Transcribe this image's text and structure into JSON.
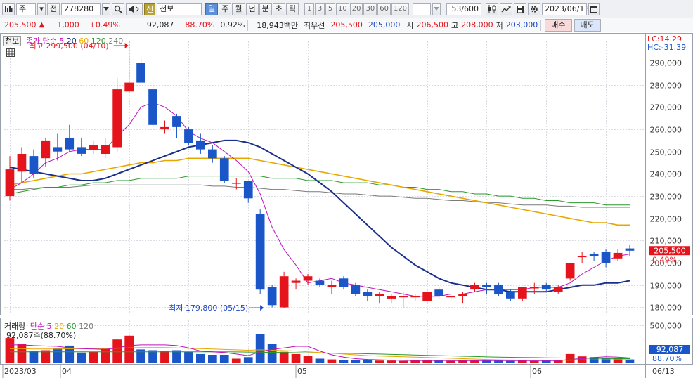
{
  "toolbar": {
    "menu_icon": "menu-icon",
    "market": "주",
    "market_arrow": "▾",
    "prev_label": "전",
    "code": "278280",
    "new_badge": "신",
    "stock_name": "천보",
    "periods": [
      "일",
      "주",
      "월",
      "년",
      "분",
      "초",
      "틱"
    ],
    "active_period": "일",
    "intervals": [
      "1",
      "3",
      "5",
      "10",
      "20",
      "30",
      "60",
      "120"
    ],
    "count": "53/600",
    "date": "2023/06/13"
  },
  "quote": {
    "price": "205,500",
    "arrow": "▲",
    "change": "1,000",
    "change_pct": "+0.49%",
    "volume": "92,087",
    "vol_ratio": "88.70%",
    "turnover_pct": "0.92%",
    "amount": "18,943백만",
    "best_ask_label": "최우선",
    "best_ask": "205,500",
    "best_bid": "205,000",
    "open_label": "시",
    "open": "206,500",
    "high_label": "고",
    "high": "208,000",
    "low_label": "저",
    "low": "203,000",
    "buy_button": "매수",
    "sell_button": "매도"
  },
  "legend": {
    "name": "천보",
    "series_label": "종가 단순",
    "ma": [
      "5",
      "20",
      "60",
      "120",
      "240"
    ],
    "ma_colors": [
      "#c010c0",
      "#1a2f8a",
      "#e6a700",
      "#2a9a2a",
      "#7a7a7a"
    ],
    "high_note": "최고 299,500 (04/10)",
    "low_note": "최저 179,800 (05/15)",
    "lc": "LC:14.29",
    "hc": "HC:-31.39"
  },
  "volume_legend": {
    "title": "거래량",
    "series_label": "단순",
    "ma": [
      "5",
      "20",
      "60",
      "120"
    ],
    "ma_colors": [
      "#c010c0",
      "#e6a700",
      "#2a9a2a",
      "#7a7a7a"
    ],
    "current": "92,087주(88.70%)"
  },
  "axis": {
    "price_ticks": [
      "290,000",
      "280,000",
      "270,000",
      "260,000",
      "250,000",
      "240,000",
      "230,000",
      "220,000",
      "210,000",
      "200,000",
      "190,000",
      "180,000"
    ],
    "current_price_label": "205,500",
    "current_pct_label": "0.49%",
    "volume_ticks": [
      "500,000"
    ],
    "current_volume_label": "92,087",
    "current_volume_pct": "88.70%",
    "date_labels": [
      "2023/03",
      "04",
      "05",
      "06",
      "06/13"
    ]
  },
  "colors": {
    "up": "#e5141c",
    "down": "#1a56c8",
    "grid": "#d8dce2",
    "price_tag": "#e5141c"
  },
  "chart_data": {
    "type": "candlestick",
    "price_ylim": [
      177000,
      299500
    ],
    "candles": [
      {
        "o": 230000,
        "h": 248000,
        "l": 228000,
        "c": 242000
      },
      {
        "o": 241000,
        "h": 252000,
        "l": 236000,
        "c": 249000
      },
      {
        "o": 248000,
        "h": 251000,
        "l": 238000,
        "c": 240000
      },
      {
        "o": 247000,
        "h": 256000,
        "l": 243000,
        "c": 255000
      },
      {
        "o": 252000,
        "h": 258000,
        "l": 246000,
        "c": 250000
      },
      {
        "o": 256000,
        "h": 262000,
        "l": 250000,
        "c": 251000
      },
      {
        "o": 252000,
        "h": 256000,
        "l": 248000,
        "c": 249000
      },
      {
        "o": 251000,
        "h": 255000,
        "l": 249000,
        "c": 253000
      },
      {
        "o": 249000,
        "h": 256000,
        "l": 247000,
        "c": 253000
      },
      {
        "o": 252000,
        "h": 283000,
        "l": 250000,
        "c": 278000
      },
      {
        "o": 277000,
        "h": 299500,
        "l": 276000,
        "c": 281000
      },
      {
        "o": 290000,
        "h": 292000,
        "l": 281000,
        "c": 281000
      },
      {
        "o": 278000,
        "h": 283000,
        "l": 260000,
        "c": 262000
      },
      {
        "o": 260000,
        "h": 264000,
        "l": 258000,
        "c": 261000
      },
      {
        "o": 266000,
        "h": 267000,
        "l": 256000,
        "c": 261000
      },
      {
        "o": 260000,
        "h": 261000,
        "l": 253000,
        "c": 254000
      },
      {
        "o": 255000,
        "h": 258000,
        "l": 249000,
        "c": 251000
      },
      {
        "o": 251000,
        "h": 253000,
        "l": 245000,
        "c": 247000
      },
      {
        "o": 247000,
        "h": 248000,
        "l": 236000,
        "c": 237000
      },
      {
        "o": 236000,
        "h": 238000,
        "l": 233000,
        "c": 236000
      },
      {
        "o": 237000,
        "h": 237000,
        "l": 227000,
        "c": 229000
      },
      {
        "o": 222000,
        "h": 224000,
        "l": 186000,
        "c": 188000
      },
      {
        "o": 189000,
        "h": 190000,
        "l": 180000,
        "c": 181000
      },
      {
        "o": 180000,
        "h": 196000,
        "l": 179800,
        "c": 194000
      },
      {
        "o": 191000,
        "h": 193000,
        "l": 188000,
        "c": 192000
      },
      {
        "o": 192000,
        "h": 195000,
        "l": 190000,
        "c": 194000
      },
      {
        "o": 192000,
        "h": 193000,
        "l": 189000,
        "c": 190000
      },
      {
        "o": 189000,
        "h": 192000,
        "l": 186000,
        "c": 190000
      },
      {
        "o": 193000,
        "h": 194000,
        "l": 188000,
        "c": 189000
      },
      {
        "o": 190000,
        "h": 191000,
        "l": 185000,
        "c": 186000
      },
      {
        "o": 187000,
        "h": 188000,
        "l": 183000,
        "c": 185000
      },
      {
        "o": 185000,
        "h": 187000,
        "l": 182000,
        "c": 186000
      },
      {
        "o": 184000,
        "h": 186000,
        "l": 182000,
        "c": 185000
      },
      {
        "o": 185000,
        "h": 187000,
        "l": 180000,
        "c": 185000
      },
      {
        "o": 185000,
        "h": 186000,
        "l": 183000,
        "c": 185000
      },
      {
        "o": 183000,
        "h": 188000,
        "l": 182000,
        "c": 187000
      },
      {
        "o": 188000,
        "h": 189000,
        "l": 184000,
        "c": 185000
      },
      {
        "o": 185000,
        "h": 186000,
        "l": 183000,
        "c": 185000
      },
      {
        "o": 185000,
        "h": 187000,
        "l": 182000,
        "c": 186000
      },
      {
        "o": 188000,
        "h": 191000,
        "l": 187000,
        "c": 190000
      },
      {
        "o": 190000,
        "h": 191000,
        "l": 186000,
        "c": 189000
      },
      {
        "o": 190000,
        "h": 191000,
        "l": 185000,
        "c": 186000
      },
      {
        "o": 187000,
        "h": 188000,
        "l": 183000,
        "c": 184000
      },
      {
        "o": 184000,
        "h": 189000,
        "l": 183000,
        "c": 189000
      },
      {
        "o": 189000,
        "h": 191000,
        "l": 186000,
        "c": 189000
      },
      {
        "o": 190000,
        "h": 191000,
        "l": 187000,
        "c": 188000
      },
      {
        "o": 187000,
        "h": 190000,
        "l": 186000,
        "c": 189000
      },
      {
        "o": 193000,
        "h": 200000,
        "l": 192000,
        "c": 200000
      },
      {
        "o": 203000,
        "h": 205000,
        "l": 200000,
        "c": 203000
      },
      {
        "o": 204000,
        "h": 205000,
        "l": 201000,
        "c": 203000
      },
      {
        "o": 205000,
        "h": 206000,
        "l": 198000,
        "c": 200000
      },
      {
        "o": 202000,
        "h": 206000,
        "l": 201000,
        "c": 204500
      },
      {
        "o": 206500,
        "h": 208000,
        "l": 203000,
        "c": 205500
      }
    ],
    "ma5": [
      233000,
      236000,
      240000,
      245000,
      247000,
      250000,
      251000,
      251000,
      251000,
      257000,
      262000,
      270000,
      272000,
      270000,
      266000,
      259000,
      256000,
      254000,
      250000,
      246000,
      241000,
      231000,
      216000,
      206000,
      199000,
      191000,
      192000,
      193000,
      191000,
      190000,
      189000,
      188000,
      187000,
      186000,
      185000,
      185000,
      185000,
      186000,
      186000,
      187000,
      188000,
      188000,
      188000,
      188000,
      189000,
      189000,
      189000,
      191000,
      195000,
      198000,
      201000,
      203000,
      204000
    ],
    "ma20": [
      243000,
      242000,
      241000,
      240000,
      239000,
      238000,
      237000,
      237000,
      238000,
      240000,
      242000,
      244000,
      246000,
      248000,
      250000,
      252000,
      253000,
      254000,
      255000,
      255000,
      254000,
      252000,
      249000,
      246000,
      243000,
      240000,
      236000,
      232000,
      227000,
      222000,
      217000,
      212000,
      207000,
      203000,
      199000,
      196000,
      193000,
      191000,
      190000,
      189000,
      188000,
      188000,
      187000,
      187000,
      187000,
      187000,
      188000,
      189000,
      190000,
      190000,
      191000,
      191000,
      192000
    ],
    "ma60": [
      235000,
      236000,
      237000,
      238000,
      239000,
      240000,
      240000,
      241000,
      242000,
      243000,
      244000,
      245000,
      245000,
      246000,
      246000,
      247000,
      247000,
      247000,
      247000,
      247000,
      247000,
      246000,
      245000,
      244000,
      243000,
      242000,
      241000,
      240000,
      239000,
      238000,
      237000,
      236000,
      235000,
      234000,
      233000,
      232000,
      231000,
      230000,
      229000,
      228000,
      227000,
      226000,
      225000,
      224000,
      223000,
      222000,
      221000,
      220000,
      219000,
      218000,
      218000,
      217000,
      217000
    ],
    "ma120": [
      231000,
      232000,
      233000,
      234000,
      234000,
      235000,
      235000,
      236000,
      236000,
      237000,
      237000,
      238000,
      238000,
      238000,
      238000,
      239000,
      239000,
      239000,
      239000,
      239000,
      239000,
      239000,
      238000,
      238000,
      238000,
      237000,
      237000,
      237000,
      236000,
      236000,
      236000,
      235000,
      235000,
      234000,
      234000,
      233000,
      233000,
      232000,
      232000,
      231000,
      231000,
      230000,
      230000,
      229000,
      229000,
      228000,
      228000,
      227000,
      227000,
      227000,
      226000,
      226000,
      226000
    ],
    "ma240": [
      233000,
      233000,
      233500,
      234000,
      234000,
      234000,
      234500,
      235000,
      235000,
      235000,
      235000,
      235000,
      235000,
      235000,
      235000,
      235000,
      235000,
      234500,
      234500,
      234000,
      234000,
      233500,
      233000,
      233000,
      232500,
      232000,
      232000,
      231500,
      231000,
      231000,
      230500,
      230000,
      230000,
      229500,
      229000,
      229000,
      228500,
      228000,
      228000,
      227500,
      227000,
      227000,
      226500,
      226000,
      226000,
      226000,
      225500,
      225500,
      225000,
      225000,
      225000,
      225000,
      225000
    ],
    "volume_ylim": [
      0,
      560000
    ],
    "volume": [
      330000,
      250000,
      160000,
      170000,
      200000,
      230000,
      140000,
      150000,
      200000,
      310000,
      360000,
      180000,
      170000,
      160000,
      170000,
      150000,
      120000,
      110000,
      110000,
      60000,
      80000,
      380000,
      250000,
      150000,
      120000,
      100000,
      60000,
      50000,
      40000,
      45000,
      40000,
      35000,
      35000,
      30000,
      35000,
      35000,
      40000,
      30000,
      35000,
      35000,
      40000,
      35000,
      30000,
      35000,
      30000,
      35000,
      40000,
      120000,
      90000,
      80000,
      60000,
      70000,
      50000
    ],
    "vol_ma5": [
      240000,
      240000,
      230000,
      225000,
      220000,
      200000,
      190000,
      185000,
      180000,
      200000,
      230000,
      240000,
      240000,
      240000,
      230000,
      200000,
      160000,
      150000,
      140000,
      120000,
      100000,
      150000,
      180000,
      200000,
      220000,
      220000,
      160000,
      110000,
      80000,
      60000,
      50000,
      45000,
      40000,
      38000,
      36000,
      36000,
      36000,
      35000,
      35000,
      35000,
      35000,
      36000,
      35000,
      34000,
      34000,
      34000,
      35000,
      50000,
      60000,
      75000,
      85000,
      80000,
      70000
    ],
    "vol_ma20": [
      190000,
      190000,
      185000,
      185000,
      185000,
      188000,
      190000,
      190000,
      190000,
      195000,
      200000,
      205000,
      205000,
      205000,
      200000,
      195000,
      190000,
      185000,
      180000,
      175000,
      170000,
      175000,
      170000,
      165000,
      160000,
      150000,
      140000,
      130000,
      120000,
      110000,
      100000,
      95000,
      90000,
      85000,
      80000,
      75000,
      70000,
      65000,
      60000,
      55000,
      50000,
      45000,
      42000,
      40000,
      38000,
      38000,
      38000,
      40000,
      42000,
      44000,
      46000,
      47000,
      48000
    ],
    "vol_ma60": [
      150000,
      150000,
      150000,
      150000,
      150000,
      150000,
      150000,
      150000,
      150000,
      150000,
      150000,
      150000,
      150000,
      150000,
      150000,
      150000,
      150000,
      150000,
      150000,
      148000,
      146000,
      144000,
      142000,
      140000,
      138000,
      136000,
      134000,
      132000,
      130000,
      128000,
      124000,
      120000,
      116000,
      112000,
      108000,
      104000,
      100000,
      96000,
      92000,
      88000,
      84000,
      80000,
      78000,
      76000,
      74000,
      72000,
      70000,
      68000,
      66000,
      64000,
      62000,
      60000,
      60000
    ]
  }
}
